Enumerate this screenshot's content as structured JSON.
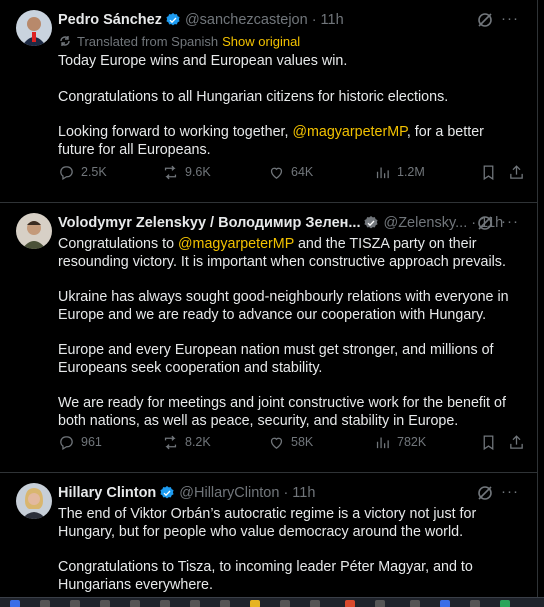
{
  "tweets": [
    {
      "name": "Pedro Sánchez",
      "handle": "@sanchezcastejon",
      "time": "11h",
      "translated_label": "Translated from Spanish",
      "show_original": "Show original",
      "paragraphs": [
        [
          "Today Europe wins and European values win."
        ],
        [
          "Congratulations to all Hungarian citizens for historic elections."
        ],
        [
          "Looking forward to working together, ",
          "@magyarpeterMP",
          ", for a better future for all Europeans."
        ]
      ],
      "replies": "2.5K",
      "reposts": "9.6K",
      "likes": "64K",
      "views": "1.2M"
    },
    {
      "name": "Volodymyr Zelenskyy / Володимир Зелен...",
      "handle": "@Zelensky...",
      "time": "11h",
      "paragraphs": [
        [
          "Congratulations to ",
          "@magyarpeterMP",
          " and the TISZA party on their resounding victory. It is important when  constructive approach prevails."
        ],
        [
          "Ukraine has always sought good-neighbourly relations with everyone in Europe and we are ready to advance our cooperation with Hungary."
        ],
        [
          "Europe and every European nation must get stronger, and millions of Europeans seek cooperation and stability."
        ],
        [
          "We are ready for meetings and joint constructive work for the benefit of both nations, as well as peace, security, and stability in Europe."
        ]
      ],
      "replies": "961",
      "reposts": "8.2K",
      "likes": "58K",
      "views": "782K"
    },
    {
      "name": "Hillary Clinton",
      "handle": "@HillaryClinton",
      "time": "11h",
      "paragraphs": [
        [
          "The end of Viktor Orbán’s autocratic regime is a victory not just for Hungary, but for people who value democracy around the world."
        ],
        [
          "Congratulations to Tisza, to incoming leader Péter Magyar, and to Hungarians everywhere."
        ]
      ]
    }
  ],
  "more_label": "···",
  "colors": {
    "accent": "#f3c200",
    "verified": "#1d9bf0",
    "muted": "#71767b",
    "text": "#e7e9ea",
    "bg": "#000000"
  }
}
